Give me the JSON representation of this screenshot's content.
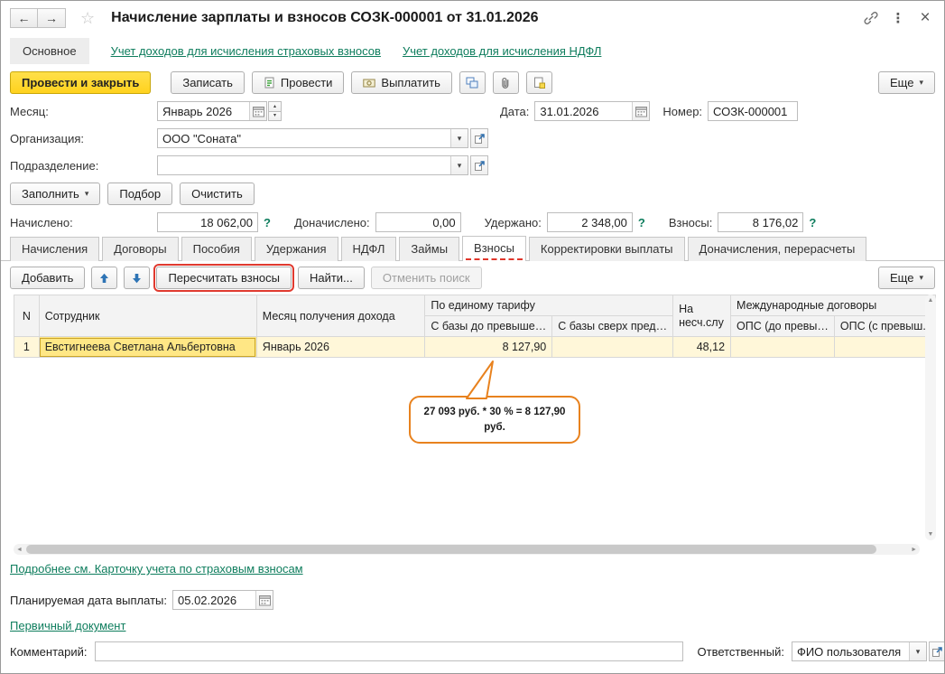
{
  "colors": {
    "link_green": "#0E7D5D",
    "primary_button_yellow": "#FFD21E",
    "annotation_red": "#E0362B",
    "callout_orange": "#E8821E",
    "row_highlight_yellow": "#FFE785"
  },
  "icons": {
    "back": "←",
    "forward": "→",
    "favorite": "☆",
    "menu": "⋮",
    "close": "×",
    "dropdown": "▾",
    "spin_up": "▴",
    "spin_down": "▾",
    "scroll_left": "◄",
    "scroll_right": "►",
    "scroll_up": "▲",
    "scroll_down": "▼",
    "help": "?"
  },
  "window": {
    "title": "Начисление зарплаты и взносов СОЗК-000001 от 31.01.2026"
  },
  "nav": {
    "main_tab": "Основное",
    "link_insurance": "Учет доходов для исчисления страховых взносов",
    "link_ndfl": "Учет доходов для исчисления НДФЛ"
  },
  "toolbar": {
    "post_and_close": "Провести и закрыть",
    "save": "Записать",
    "post": "Провести",
    "pay": "Выплатить",
    "more": "Еще"
  },
  "form": {
    "month_label": "Месяц:",
    "month_value": "Январь 2026",
    "date_label": "Дата:",
    "date_value": "31.01.2026",
    "number_label": "Номер:",
    "number_value": "СОЗК-000001",
    "organization_label": "Организация:",
    "organization_value": "ООО \"Соната\"",
    "department_label": "Подразделение:",
    "department_value": "",
    "fill": "Заполнить",
    "pick": "Подбор",
    "clear": "Очистить",
    "accrued_label": "Начислено:",
    "accrued_value": "18 062,00",
    "added_label": "Доначислено:",
    "added_value": "0,00",
    "withheld_label": "Удержано:",
    "withheld_value": "2 348,00",
    "contributions_label": "Взносы:",
    "contributions_value": "8 176,02"
  },
  "tabs": [
    "Начисления",
    "Договоры",
    "Пособия",
    "Удержания",
    "НДФЛ",
    "Займы",
    "Взносы",
    "Корректировки выплаты",
    "Доначисления, перерасчеты"
  ],
  "grid_toolbar": {
    "add": "Добавить",
    "recalculate": "Пересчитать взносы",
    "find": "Найти...",
    "cancel_search": "Отменить поиск",
    "more": "Еще"
  },
  "grid": {
    "col_n": "N",
    "col_employee": "Сотрудник",
    "col_month": "Месяц получения дохода",
    "col_single_tariff": "По единому тарифу",
    "col_base_below": "С базы до превыше…",
    "col_base_above": "С базы сверх пред…",
    "col_accident": "На несч.слу",
    "col_international": "Международные договоры",
    "col_ops_below": "ОПС (до превы…",
    "col_ops_above": "ОПС (с превыш.)",
    "rows": [
      {
        "n": "1",
        "employee": "Евстигнеева Светлана Альбертовна",
        "month": "Январь 2026",
        "base_below": "8 127,90",
        "base_above": "",
        "accident": "48,12",
        "ops_below": "",
        "ops_above": ""
      }
    ]
  },
  "callout": {
    "text": "27 093 руб. * 30 % = 8 127,90 руб."
  },
  "footer": {
    "details_link": "Подробнее см. Карточку учета по страховым взносам",
    "planned_date_label": "Планируемая дата выплаты:",
    "planned_date_value": "05.02.2026",
    "primary_document_link": "Первичный документ",
    "comment_label": "Комментарий:",
    "comment_value": "",
    "responsible_label": "Ответственный:",
    "responsible_value": "ФИО пользователя"
  }
}
